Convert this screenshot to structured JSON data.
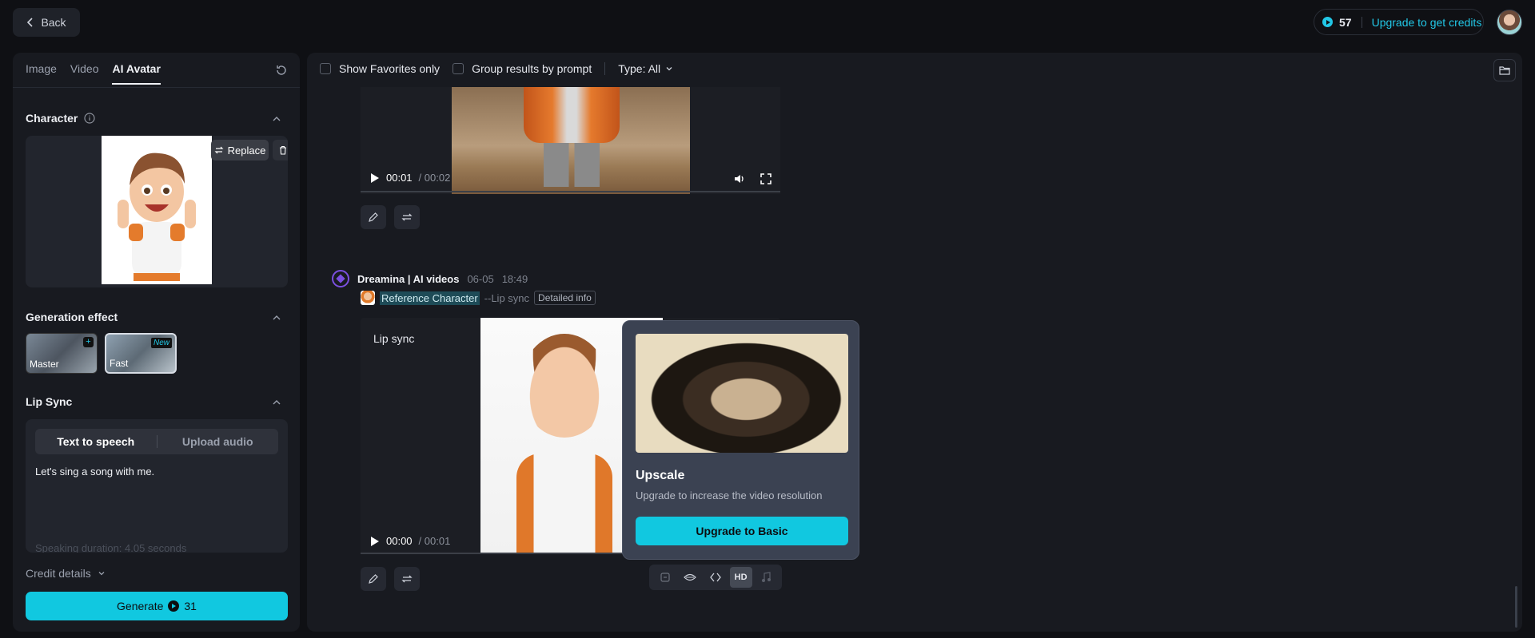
{
  "topbar": {
    "back_label": "Back",
    "credits": "57",
    "upgrade_label": "Upgrade to get credits",
    "accent": "#22c7e6"
  },
  "left": {
    "tabs": [
      {
        "label": "Image"
      },
      {
        "label": "Video"
      },
      {
        "label": "AI Avatar"
      }
    ],
    "character": {
      "title": "Character",
      "replace_label": "Replace"
    },
    "generation_effect": {
      "title": "Generation effect",
      "options": [
        {
          "label": "Master",
          "badge": "+"
        },
        {
          "label": "Fast",
          "badge": "New"
        }
      ]
    },
    "lip_sync": {
      "title": "Lip Sync",
      "modes": [
        "Text to speech",
        "Upload audio"
      ],
      "text": "Let's sing a song with me.",
      "duration": "Speaking duration: 4.05 seconds"
    },
    "credit_details": "Credit details",
    "generate": {
      "label": "Generate",
      "cost": "31"
    }
  },
  "main": {
    "filters": {
      "favorites": "Show Favorites only",
      "group": "Group results by prompt",
      "type": "Type: All"
    },
    "video1": {
      "current": "00:01",
      "total": "/ 00:02"
    },
    "entry": {
      "author": "Dreamina | AI videos",
      "date": "06-05",
      "time": "18:49",
      "reference": "Reference Character",
      "mode_tag": "--Lip sync",
      "detail": "Detailed info"
    },
    "video2": {
      "label": "Lip sync",
      "current": "00:00",
      "total": "/ 00:01"
    },
    "upscale": {
      "title": "Upscale",
      "desc": "Upgrade to increase the video resolution",
      "button": "Upgrade to Basic"
    },
    "tools": {
      "hd": "HD"
    }
  }
}
